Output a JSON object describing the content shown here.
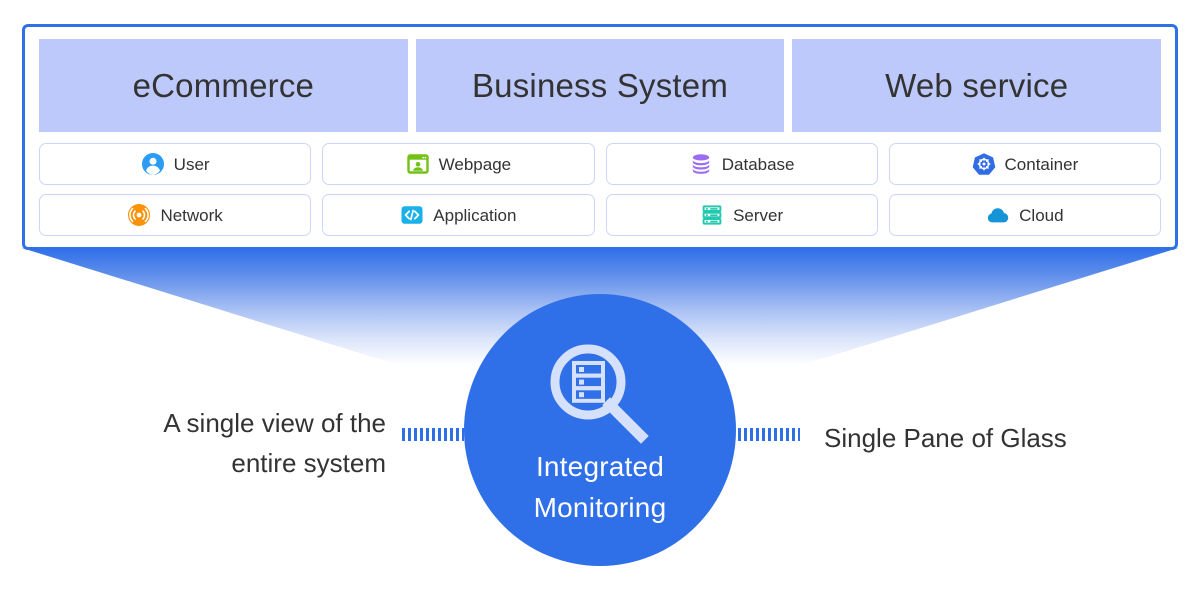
{
  "colors": {
    "frame_blue": "#2f6fe8",
    "tab_fill": "#bdc8fb",
    "card_border": "#ccd6f7",
    "hub_fill": "#2f6fe8",
    "glass_light": "#d5e0fa",
    "text_dark": "#333333"
  },
  "panel": {
    "tabs": [
      {
        "label": "eCommerce"
      },
      {
        "label": "Business System"
      },
      {
        "label": "Web service"
      }
    ],
    "items": [
      {
        "label": "User",
        "icon": "user-icon"
      },
      {
        "label": "Webpage",
        "icon": "webpage-icon"
      },
      {
        "label": "Database",
        "icon": "database-icon"
      },
      {
        "label": "Container",
        "icon": "container-icon"
      },
      {
        "label": "Network",
        "icon": "network-icon"
      },
      {
        "label": "Application",
        "icon": "application-icon"
      },
      {
        "label": "Server",
        "icon": "server-icon"
      },
      {
        "label": "Cloud",
        "icon": "cloud-icon"
      }
    ]
  },
  "hub": {
    "icon": "magnifier-server-icon",
    "title_line1": "Integrated",
    "title_line2": "Monitoring"
  },
  "captions": {
    "left_line1": "A single view of the",
    "left_line2": "entire system",
    "right": "Single Pane of Glass"
  }
}
